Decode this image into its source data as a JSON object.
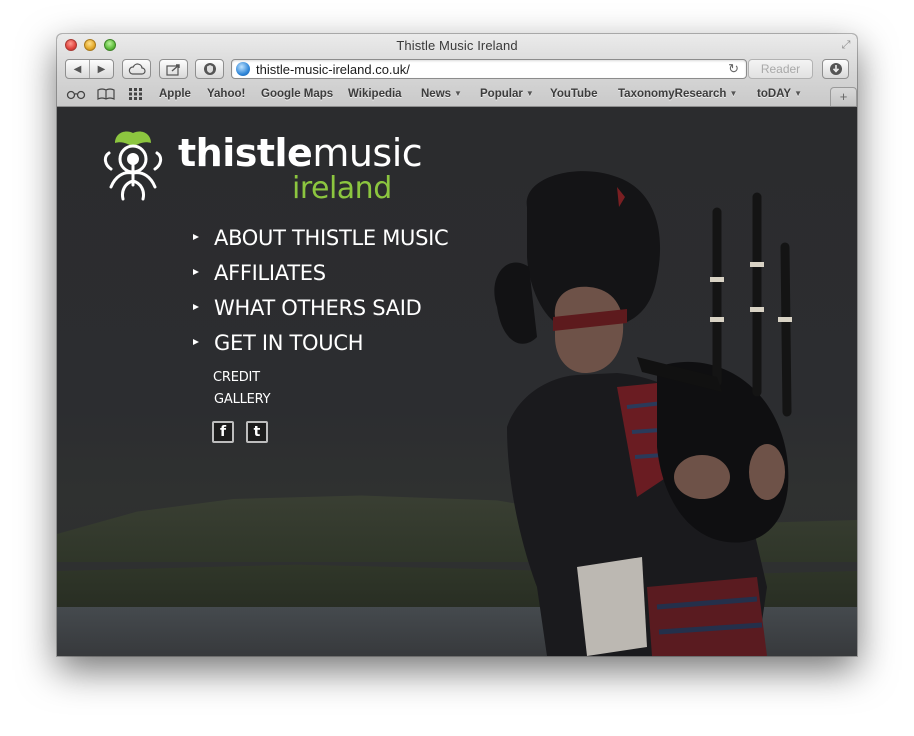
{
  "window": {
    "title": "Thistle Music Ireland"
  },
  "toolbar": {
    "url": "thistle-music-ireland.co.uk/",
    "reader_label": "Reader",
    "back_icon": "back-arrow-icon",
    "forward_icon": "forward-arrow-icon",
    "icloud_icon": "cloud-icon",
    "share_icon": "share-icon",
    "extension_icon": "shield-icon",
    "download_icon": "download-icon",
    "reload_icon": "reload-icon"
  },
  "bookmarks": {
    "icons": [
      "reading-list-icon",
      "bookmarks-book-icon",
      "top-sites-grid-icon"
    ],
    "items": [
      {
        "label": "Apple",
        "dropdown": false
      },
      {
        "label": "Yahoo!",
        "dropdown": false
      },
      {
        "label": "Google Maps",
        "dropdown": false
      },
      {
        "label": "Wikipedia",
        "dropdown": false
      },
      {
        "label": "News",
        "dropdown": true
      },
      {
        "label": "Popular",
        "dropdown": true
      },
      {
        "label": "YouTube",
        "dropdown": false
      },
      {
        "label": "TaxonomyResearch",
        "dropdown": true
      },
      {
        "label": "toDAY",
        "dropdown": true
      }
    ],
    "new_tab": "+"
  },
  "site": {
    "logo": {
      "word_bold": "thistle",
      "word_light": "music",
      "sub": "ireland"
    },
    "menu": [
      {
        "label": "ABOUT THISTLE MUSIC"
      },
      {
        "label": "AFFILIATES"
      },
      {
        "label": "WHAT OTHERS SAID"
      },
      {
        "label": "GET IN TOUCH"
      }
    ],
    "sub_links": [
      "CREDIT",
      "GALLERY"
    ],
    "social": {
      "facebook": "f",
      "twitter": "t"
    }
  },
  "colors": {
    "brand_green": "#8cc63f",
    "page_bg": "#2b2c2e",
    "menu_text": "#ffffff"
  }
}
